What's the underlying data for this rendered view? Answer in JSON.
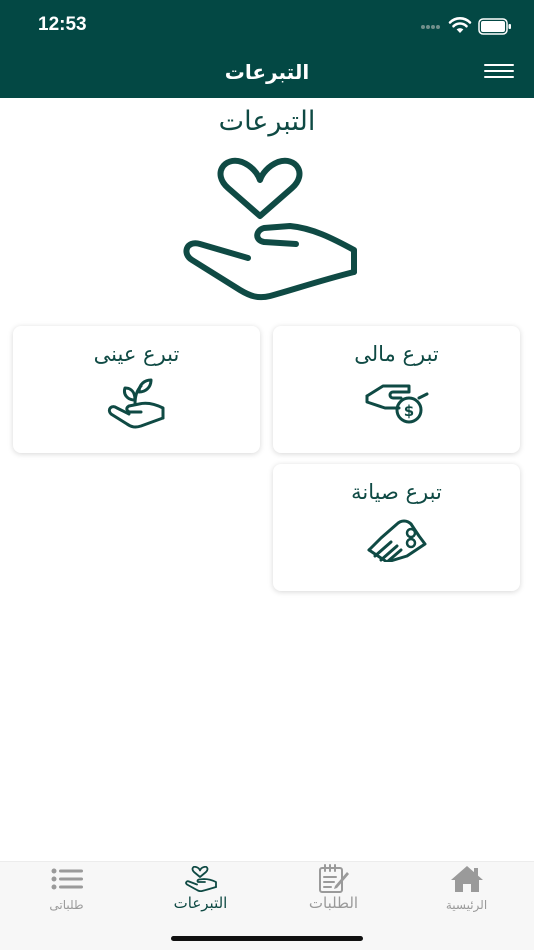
{
  "status_bar": {
    "time": "12:53"
  },
  "header": {
    "title": "التبرعات",
    "menu_icon": "hamburger-menu-icon"
  },
  "main": {
    "title": "التبرعات",
    "hero_icon": "heart-in-hand-icon",
    "cards": [
      {
        "label": "تبرع مالى",
        "icon": "money-hand-icon"
      },
      {
        "label": "تبرع عينى",
        "icon": "plant-hand-icon"
      },
      {
        "label": "تبرع صيانة",
        "icon": "maintenance-hand-icon"
      }
    ]
  },
  "tabbar": {
    "items": [
      {
        "label": "الرئيسية",
        "icon": "home-icon",
        "active": false
      },
      {
        "label": "الطلبات",
        "icon": "notepad-icon",
        "active": false
      },
      {
        "label": "التبرعات",
        "icon": "donation-hand-icon",
        "active": true
      },
      {
        "label": "طلباتى",
        "icon": "list-icon",
        "active": false
      }
    ]
  },
  "colors": {
    "primary": "#034844",
    "text": "#0f4a44",
    "inactive": "#9a9a9a",
    "tabbar_bg": "#f7f7f7"
  }
}
